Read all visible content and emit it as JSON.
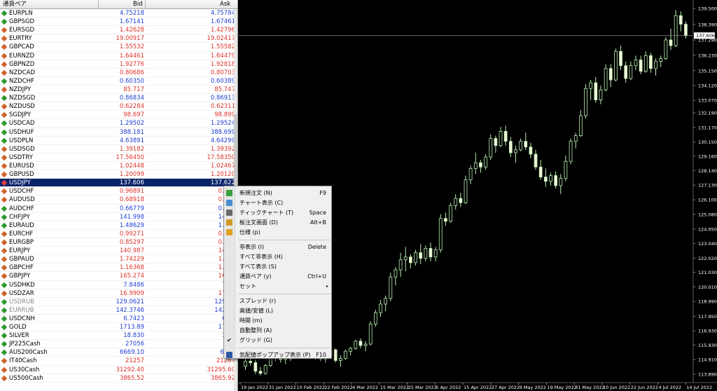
{
  "market_watch": {
    "col_symbol": "通貨ペア",
    "col_bid": "Bid",
    "col_ask": "Ask",
    "rows": [
      {
        "symbol": "EURPLN",
        "bid": "4.75218",
        "ask": "4.75784",
        "dir": "up"
      },
      {
        "symbol": "GBPSGD",
        "bid": "1.67141",
        "ask": "1.67461",
        "dir": "up"
      },
      {
        "symbol": "EURSGD",
        "bid": "1.42628",
        "ask": "1.42796",
        "dir": "dn"
      },
      {
        "symbol": "EURTRY",
        "bid": "19.00917",
        "ask": "19.02417",
        "dir": "dn"
      },
      {
        "symbol": "GBPCAD",
        "bid": "1.55532",
        "ask": "1.55582",
        "dir": "dn"
      },
      {
        "symbol": "EURNZD",
        "bid": "1.64461",
        "ask": "1.64479",
        "dir": "dn"
      },
      {
        "symbol": "GBPNZD",
        "bid": "1.92776",
        "ask": "1.92818",
        "dir": "dn"
      },
      {
        "symbol": "NZDCAD",
        "bid": "0.80686",
        "ask": "0.80703",
        "dir": "dn"
      },
      {
        "symbol": "NZDCHF",
        "bid": "0.60350",
        "ask": "0.60389",
        "dir": "up"
      },
      {
        "symbol": "NZDJPY",
        "bid": "85.717",
        "ask": "85.747",
        "dir": "dn"
      },
      {
        "symbol": "NZDSGD",
        "bid": "0.86834",
        "ask": "0.86913",
        "dir": "up"
      },
      {
        "symbol": "NZDUSD",
        "bid": "0.62284",
        "ask": "0.62311",
        "dir": "dn"
      },
      {
        "symbol": "SGDJPY",
        "bid": "98.697",
        "ask": "98.899",
        "dir": "dn"
      },
      {
        "symbol": "USDCAD",
        "bid": "1.29502",
        "ask": "1.29524",
        "dir": "up"
      },
      {
        "symbol": "USDHUF",
        "bid": "388.181",
        "ask": "388.699",
        "dir": "up"
      },
      {
        "symbol": "USDPLN",
        "bid": "4.63891",
        "ask": "4.64299",
        "dir": "up"
      },
      {
        "symbol": "USDSGD",
        "bid": "1.39182",
        "ask": "1.39392",
        "dir": "dn"
      },
      {
        "symbol": "USDTRY",
        "bid": "17.56450",
        "ask": "17.58350",
        "dir": "dn"
      },
      {
        "symbol": "EURUSD",
        "bid": "1.02448",
        "ask": "1.02467",
        "dir": "dn"
      },
      {
        "symbol": "GBPUSD",
        "bid": "1.20099",
        "ask": "1.20120",
        "dir": "dn"
      },
      {
        "symbol": "USDJPY",
        "bid": "137.606",
        "ask": "137.622",
        "dir": "up",
        "selected": true
      },
      {
        "symbol": "USDCHF",
        "bid": "0.96891",
        "ask": "0.969",
        "dir": "dn"
      },
      {
        "symbol": "AUDUSD",
        "bid": "0.68918",
        "ask": "0.689",
        "dir": "dn"
      },
      {
        "symbol": "AUDCHF",
        "bid": "0.66779",
        "ask": "0.668",
        "dir": "up"
      },
      {
        "symbol": "CHFJPY",
        "bid": "141.998",
        "ask": "142.0",
        "dir": "up"
      },
      {
        "symbol": "EURAUD",
        "bid": "1.48629",
        "ask": "1.486",
        "dir": "up"
      },
      {
        "symbol": "EURCHF",
        "bid": "0.99271",
        "ask": "0.992",
        "dir": "dn"
      },
      {
        "symbol": "EURGBP",
        "bid": "0.85297",
        "ask": "0.853",
        "dir": "dn"
      },
      {
        "symbol": "EURJPY",
        "bid": "140.987",
        "ask": "141.0",
        "dir": "dn"
      },
      {
        "symbol": "GBPAUD",
        "bid": "1.74229",
        "ask": "1.742",
        "dir": "dn"
      },
      {
        "symbol": "GBPCHF",
        "bid": "1.16368",
        "ask": "1.164",
        "dir": "dn"
      },
      {
        "symbol": "GBPJPY",
        "bid": "165.274",
        "ask": "165.3",
        "dir": "dn"
      },
      {
        "symbol": "USDHKD",
        "bid": "7.8486",
        "ask": "7.85",
        "dir": "up"
      },
      {
        "symbol": "USDZAR",
        "bid": "16.9909",
        "ask": "17.00",
        "dir": "dn"
      },
      {
        "symbol": "USDRUB",
        "bid": "129.0621",
        "ask": "129.06",
        "dir": "up",
        "dim": true
      },
      {
        "symbol": "EURRUB",
        "bid": "142.3746",
        "ask": "142.37",
        "dir": "up",
        "dim": true
      },
      {
        "symbol": "USDCNH",
        "bid": "6.7423",
        "ask": "6.74",
        "dir": "up"
      },
      {
        "symbol": "GOLD",
        "bid": "1713.89",
        "ask": "1714.",
        "dir": "up"
      },
      {
        "symbol": "SILVER",
        "bid": "18.830",
        "ask": "18.8",
        "dir": "up"
      },
      {
        "symbol": "JP225Cash",
        "bid": "27056",
        "ask": "270",
        "dir": "up"
      },
      {
        "symbol": "AUS200Cash",
        "bid": "6669.10",
        "ask": "6674",
        "dir": "up"
      },
      {
        "symbol": "IT40Cash",
        "bid": "21257",
        "ask": "21267",
        "dir": "dn"
      },
      {
        "symbol": "US30Cash",
        "bid": "31292.40",
        "ask": "31295.60",
        "dir": "dn"
      },
      {
        "symbol": "US500Cash",
        "bid": "3865.52",
        "ask": "3865.92",
        "dir": "dn"
      }
    ]
  },
  "context_menu": {
    "items": [
      {
        "label": "新規注文 (N)",
        "shortcut": "F9",
        "icon": "new-order-icon",
        "icon_color": "#3aa23a"
      },
      {
        "label": "チャート表示 (C)",
        "shortcut": "",
        "icon": "chart-window-icon",
        "icon_color": "#4a8fd4"
      },
      {
        "label": "ティックチャート (T)",
        "shortcut": "Space",
        "icon": "tick-chart-icon",
        "icon_color": "#6a6a6a"
      },
      {
        "label": "板注文画面 (D)",
        "shortcut": "Alt+B",
        "icon": "depth-of-market-icon",
        "icon_color": "#d49a2a"
      },
      {
        "label": "仕様 (p)",
        "shortcut": "",
        "icon": "specification-icon",
        "icon_color": "#e0a020"
      },
      {
        "sep": true
      },
      {
        "label": "非表示 (I)",
        "shortcut": "Delete"
      },
      {
        "label": "すべて非表示 (H)",
        "shortcut": ""
      },
      {
        "label": "すべて表示 (S)",
        "shortcut": ""
      },
      {
        "label": "通貨ペア (y)",
        "shortcut": "Ctrl+U"
      },
      {
        "label": "セット",
        "shortcut": "",
        "submenu": true
      },
      {
        "sep": true
      },
      {
        "label": "スプレッド (r)",
        "shortcut": ""
      },
      {
        "label": "高値/安値 (L)",
        "shortcut": ""
      },
      {
        "label": "時間 (m)",
        "shortcut": ""
      },
      {
        "label": "自動整列 (A)",
        "shortcut": ""
      },
      {
        "label": "グリッド (G)",
        "shortcut": "",
        "checked": true
      },
      {
        "sep": true
      },
      {
        "label": "気配値ポップアップ表示 (P)",
        "shortcut": "F10",
        "icon": "popup-prices-icon",
        "icon_color": "#2a5aa8"
      }
    ],
    "check_glyph": "✔",
    "submenu_glyph": "▸"
  },
  "chart": {
    "symbol": "USDJPY",
    "current_price": "137.606",
    "colors": {
      "background": "#000000",
      "candle_up": "#000000",
      "candle_down": "#f5f5dc",
      "wick": "#b8f0b0",
      "axis_text": "#ffffff",
      "bid_line": "#8c8c8c"
    },
    "y_ticks": [
      "139.500",
      "138.390",
      "137.290",
      "136.230",
      "135.150",
      "134.120",
      "133.070",
      "132.190",
      "131.170",
      "130.150",
      "129.160",
      "128.140",
      "127.130",
      "126.100",
      "125.080",
      "124.050",
      "123.040",
      "122.020",
      "121.030",
      "120.010",
      "118.990",
      "117.950",
      "116.930",
      "115.930",
      "114.910",
      "113.890"
    ],
    "x_ticks": [
      "19 Jan 2022",
      "31 Jan 2022",
      "10 Feb 2022",
      "22 Feb 2022",
      "4 Mar 2022",
      "15 Mar 2022",
      "25 Mar 2022",
      "5 Apr 2022",
      "15 Apr 2022",
      "27 Apr 2022",
      "9 May 2022",
      "19 May 2022",
      "31 May 2022",
      "10 Jun 2022",
      "22 Jun 2022",
      "4 Jul 2022",
      "14 Jul 2022"
    ]
  },
  "chart_data": {
    "type": "candlestick",
    "title": "",
    "ylim": [
      113.4,
      139.9
    ],
    "x_start": "2022-01-19",
    "series": [
      {
        "name": "",
        "values": [
          [
            114.45,
            115.0,
            114.2,
            114.8
          ],
          [
            114.8,
            115.1,
            114.5,
            114.7
          ],
          [
            114.7,
            114.9,
            113.9,
            114.1
          ],
          [
            114.1,
            114.4,
            113.8,
            113.95
          ],
          [
            113.95,
            114.6,
            113.85,
            114.5
          ],
          [
            114.5,
            115.6,
            114.4,
            115.4
          ],
          [
            115.4,
            115.7,
            114.8,
            115.1
          ],
          [
            115.1,
            115.3,
            114.7,
            114.9
          ],
          [
            114.9,
            115.2,
            114.6,
            114.95
          ],
          [
            114.95,
            115.5,
            114.8,
            115.3
          ],
          [
            115.3,
            116.3,
            115.2,
            116.0
          ],
          [
            116.0,
            116.1,
            115.4,
            115.6
          ],
          [
            115.6,
            115.9,
            115.3,
            115.45
          ],
          [
            115.45,
            115.8,
            114.95,
            115.1
          ],
          [
            115.1,
            115.6,
            114.9,
            115.5
          ],
          [
            115.5,
            115.7,
            114.8,
            114.95
          ],
          [
            114.95,
            115.3,
            114.7,
            115.2
          ],
          [
            115.2,
            115.8,
            115.0,
            115.6
          ],
          [
            115.6,
            115.7,
            114.7,
            114.85
          ],
          [
            114.85,
            115.2,
            114.4,
            115.0
          ],
          [
            115.0,
            115.6,
            114.9,
            115.5
          ],
          [
            115.5,
            115.8,
            115.2,
            115.7
          ],
          [
            115.7,
            116.3,
            115.6,
            116.2
          ],
          [
            116.2,
            116.4,
            115.7,
            115.9
          ],
          [
            115.9,
            116.2,
            115.5,
            116.0
          ],
          [
            116.0,
            117.6,
            115.9,
            117.4
          ],
          [
            117.4,
            118.4,
            117.2,
            118.2
          ],
          [
            118.2,
            119.1,
            117.9,
            118.8
          ],
          [
            118.8,
            119.4,
            118.3,
            119.2
          ],
          [
            119.2,
            121.0,
            119.0,
            120.7
          ],
          [
            120.7,
            121.4,
            120.1,
            121.2
          ],
          [
            121.2,
            122.4,
            120.7,
            121.9
          ],
          [
            121.9,
            122.8,
            121.1,
            122.1
          ],
          [
            122.1,
            122.3,
            121.3,
            121.7
          ],
          [
            121.7,
            122.6,
            121.5,
            122.4
          ],
          [
            122.4,
            123.0,
            121.6,
            122.0
          ],
          [
            122.0,
            122.9,
            121.8,
            122.7
          ],
          [
            122.7,
            123.1,
            121.8,
            122.1
          ],
          [
            122.1,
            122.8,
            121.8,
            122.6
          ],
          [
            122.6,
            125.1,
            122.4,
            124.8
          ],
          [
            124.8,
            125.2,
            124.3,
            124.6
          ],
          [
            124.6,
            125.9,
            124.5,
            125.7
          ],
          [
            125.7,
            126.5,
            125.4,
            126.2
          ],
          [
            126.2,
            126.6,
            125.6,
            125.9
          ],
          [
            125.9,
            127.8,
            125.8,
            127.5
          ],
          [
            127.5,
            128.5,
            127.2,
            128.3
          ],
          [
            128.3,
            129.4,
            127.9,
            128.7
          ],
          [
            128.7,
            128.9,
            128.0,
            128.4
          ],
          [
            128.4,
            129.3,
            128.2,
            129.1
          ],
          [
            129.1,
            130.7,
            128.9,
            130.4
          ],
          [
            130.4,
            130.6,
            129.4,
            129.9
          ],
          [
            129.9,
            131.2,
            129.8,
            130.9
          ],
          [
            130.9,
            131.3,
            129.9,
            130.2
          ],
          [
            130.2,
            130.5,
            129.1,
            129.4
          ],
          [
            129.4,
            129.9,
            128.7,
            129.6
          ],
          [
            129.6,
            130.4,
            129.5,
            130.2
          ],
          [
            130.2,
            130.8,
            129.6,
            129.8
          ],
          [
            129.8,
            130.1,
            129.0,
            129.3
          ],
          [
            129.3,
            129.6,
            128.2,
            128.4
          ],
          [
            128.4,
            128.9,
            127.5,
            127.7
          ],
          [
            127.7,
            128.3,
            127.0,
            127.4
          ],
          [
            127.4,
            128.0,
            127.1,
            127.8
          ],
          [
            127.8,
            128.1,
            126.9,
            127.1
          ],
          [
            127.1,
            127.9,
            126.5,
            127.6
          ],
          [
            127.6,
            129.2,
            127.4,
            128.8
          ],
          [
            128.8,
            130.4,
            128.6,
            130.2
          ],
          [
            130.2,
            130.8,
            129.7,
            130.6
          ],
          [
            130.6,
            132.4,
            130.5,
            132.0
          ],
          [
            132.0,
            134.2,
            131.8,
            133.9
          ],
          [
            133.9,
            134.5,
            133.1,
            134.3
          ],
          [
            134.3,
            134.7,
            132.9,
            133.1
          ],
          [
            133.1,
            134.1,
            132.8,
            133.8
          ],
          [
            133.8,
            135.6,
            133.7,
            135.3
          ],
          [
            135.3,
            135.6,
            134.0,
            134.5
          ],
          [
            134.5,
            136.7,
            134.4,
            136.5
          ],
          [
            136.5,
            136.9,
            135.2,
            135.5
          ],
          [
            135.5,
            135.8,
            134.3,
            134.6
          ],
          [
            134.6,
            135.8,
            134.5,
            135.5
          ],
          [
            135.5,
            136.2,
            135.2,
            135.9
          ],
          [
            135.9,
            136.2,
            134.9,
            135.1
          ],
          [
            135.1,
            136.5,
            135.0,
            136.2
          ],
          [
            136.2,
            136.4,
            135.0,
            135.3
          ],
          [
            135.3,
            136.0,
            134.8,
            135.8
          ],
          [
            135.8,
            136.2,
            135.4,
            136.0
          ],
          [
            136.0,
            137.5,
            135.9,
            137.3
          ],
          [
            137.3,
            138.1,
            136.6,
            136.9
          ],
          [
            136.9,
            139.4,
            136.8,
            139.0
          ],
          [
            139.0,
            139.3,
            137.9,
            138.4
          ],
          [
            138.4,
            138.6,
            137.4,
            137.6
          ]
        ]
      }
    ]
  }
}
